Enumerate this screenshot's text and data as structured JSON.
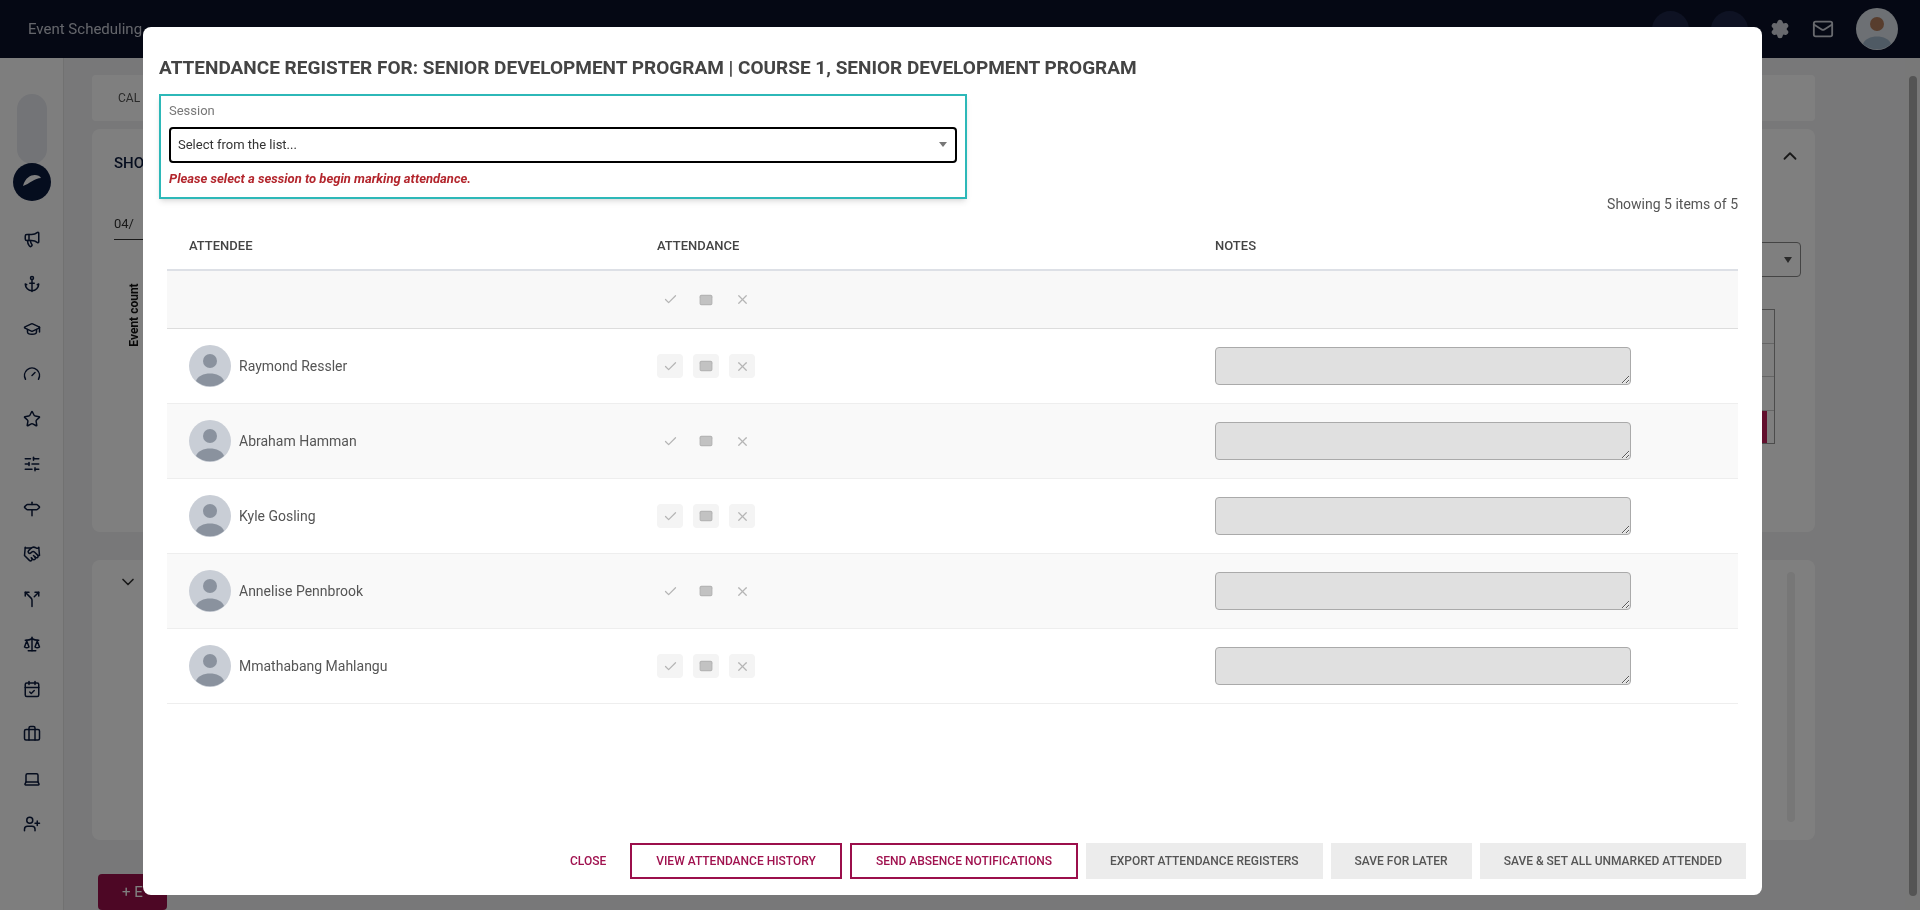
{
  "app": {
    "title": "Event Scheduling"
  },
  "background": {
    "tab": "CAL",
    "panel_title": "SHO",
    "date_value": "04/",
    "chart_ylabel": "Event count",
    "add_button": "+ E"
  },
  "dialog": {
    "title": "ATTENDANCE REGISTER FOR: SENIOR DEVELOPMENT PROGRAM | COURSE 1, SENIOR DEVELOPMENT PROGRAM",
    "session": {
      "label": "Session",
      "placeholder": "Select from the list...",
      "error": "Please select a session to begin marking attendance."
    },
    "count": "Showing 5 items of 5",
    "columns": [
      "ATTENDEE",
      "ATTENDANCE",
      "NOTES"
    ],
    "rows": [
      {
        "name": "Raymond Ressler"
      },
      {
        "name": "Abraham Hamman"
      },
      {
        "name": "Kyle Gosling"
      },
      {
        "name": "Annelise Pennbrook"
      },
      {
        "name": "Mmathabang Mahlangu"
      }
    ],
    "buttons": [
      {
        "label": "CLOSE",
        "kind": "text"
      },
      {
        "label": "VIEW ATTENDANCE HISTORY",
        "kind": "outline"
      },
      {
        "label": "SEND ABSENCE NOTIFICATIONS",
        "kind": "outline"
      },
      {
        "label": "EXPORT ATTENDANCE REGISTERS",
        "kind": "flat"
      },
      {
        "label": "SAVE FOR LATER",
        "kind": "flat"
      },
      {
        "label": "SAVE & SET ALL UNMARKED ATTENDED",
        "kind": "flat"
      }
    ]
  }
}
